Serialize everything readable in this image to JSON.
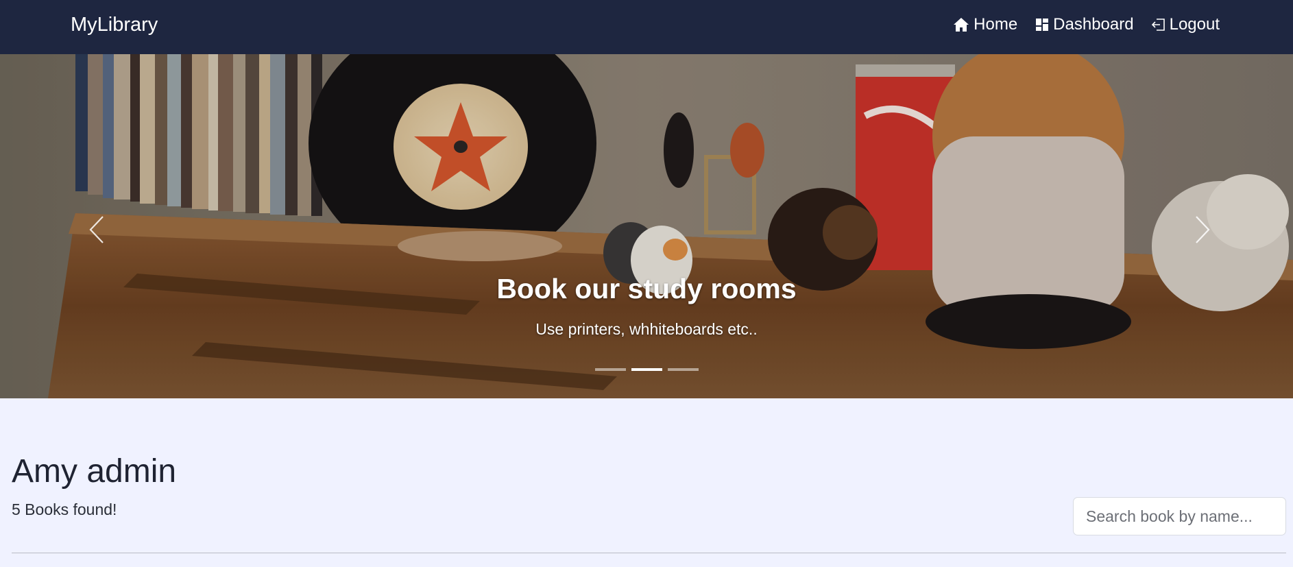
{
  "navbar": {
    "brand": "MyLibrary",
    "links": [
      {
        "label": "Home",
        "icon": "home-icon"
      },
      {
        "label": "Dashboard",
        "icon": "dashboard-icon"
      },
      {
        "label": "Logout",
        "icon": "logout-icon"
      }
    ],
    "background": "#1e2640"
  },
  "carousel": {
    "caption_title": "Book our study rooms",
    "caption_text": "Use printers, whhiteboards etc..",
    "slide_count": 3,
    "active_slide": 2,
    "prev_icon": "chevron-left-icon",
    "next_icon": "chevron-right-icon"
  },
  "main": {
    "user_name": "Amy admin",
    "books_found": "5 Books found!",
    "search_placeholder": "Search book by name..."
  },
  "colors": {
    "page_background": "#f0f2ff",
    "text": "#212529"
  }
}
